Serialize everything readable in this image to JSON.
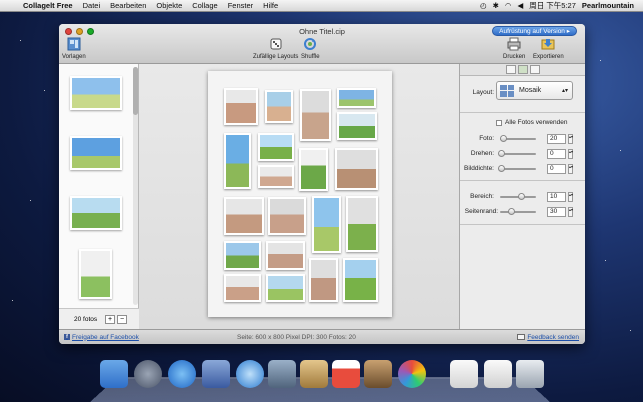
{
  "menubar": {
    "app_name": "Collagelt Free",
    "items": [
      "Datei",
      "Bearbeiten",
      "Objekte",
      "Collage",
      "Fenster",
      "Hilfe"
    ],
    "clock": "周日 下午5:27",
    "user": "Pearlmountain"
  },
  "window": {
    "title": "Ohne Titel.cip",
    "upgrade_label": "Aufrüstung auf Version",
    "toolbar": {
      "templates_label": "Vorlagen",
      "random_layouts_label": "Zufällige Layouts",
      "shuffle_label": "Shuffle",
      "print_label": "Drucken",
      "export_label": "Exportieren"
    }
  },
  "sidebar": {
    "photo_count": "20 fotos",
    "add_label": "+",
    "remove_label": "−"
  },
  "inspector": {
    "layout_label": "Layout:",
    "layout_value": "Mosaik",
    "all_photos_label": "Alle Fotos verwenden",
    "photo_label": "Foto:",
    "photo_value": "20",
    "rotate_label": "Drehen:",
    "rotate_value": "0",
    "density_label": "Bilddichte:",
    "density_value": "0",
    "area_label": "Bereich:",
    "area_value": "10",
    "margin_label": "Seitenrand:",
    "margin_value": "30"
  },
  "statusbar": {
    "facebook_label": "Freigabe auf Facebook",
    "info": "Seite: 600 x 800 Pixel  DPI: 300  Fotos: 20",
    "feedback_label": "Feedback senden"
  }
}
